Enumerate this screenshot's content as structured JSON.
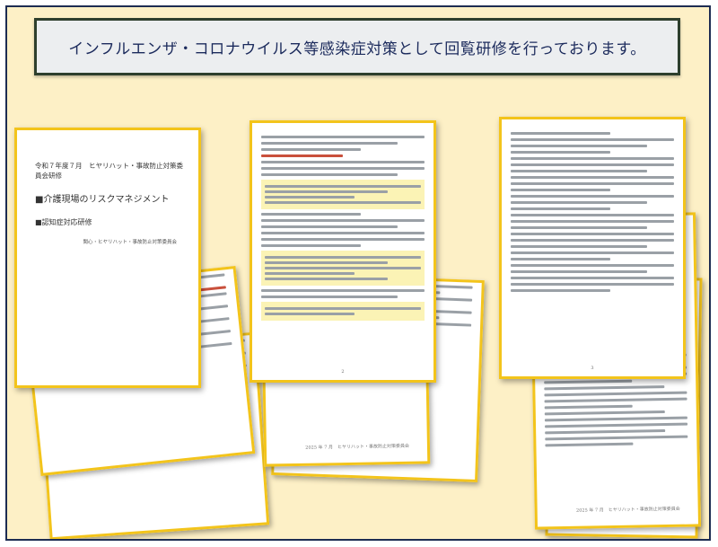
{
  "banner": {
    "text": "インフルエンザ・コロナウイルス等感染症対策として回覧研修を行っております。"
  },
  "cover_page": {
    "header": "令和７年度７月　ヒヤリハット・事故防止対策委員会研修",
    "title": "■介護現場のリスクマネジメント",
    "subtitle": "■認知症対応研修",
    "org": "聞心・ヒヤリハット・事故防止対策委員会"
  },
  "footers": {
    "center_page": "2025 年 7 月　ヒヤリハット・事故防止対策委員会",
    "right_page": "2025 年 7 月　ヒヤリハット・事故防止対策委員会"
  },
  "colors": {
    "board_bg": "#fdf0c6",
    "banner_bg": "#eceef0",
    "page_border": "#f3c41b"
  }
}
